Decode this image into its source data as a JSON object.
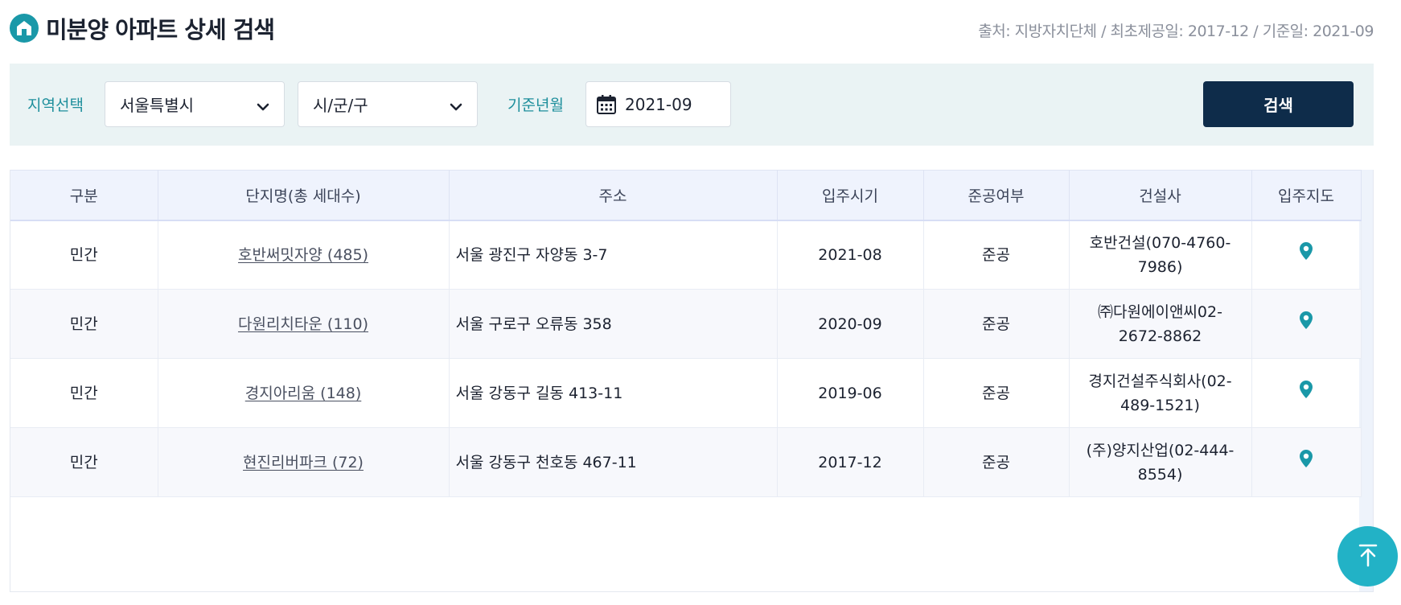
{
  "header": {
    "title": "미분양 아파트 상세 검색",
    "source": "출처: 지방자치단체 / 최초제공일: 2017-12 / 기준일: 2021-09"
  },
  "filters": {
    "region_label": "지역선택",
    "province": "서울특별시",
    "district": "시/군/구",
    "date_label": "기준년월",
    "date_value": "2021-09",
    "search_label": "검색"
  },
  "table": {
    "columns": [
      "구분",
      "단지명(총 세대수)",
      "주소",
      "입주시기",
      "준공여부",
      "건설사",
      "입주지도"
    ],
    "rows": [
      {
        "type": "민간",
        "name": "호반써밋자양 (485)",
        "address": "서울 광진구 자양동 3-7",
        "move_in": "2021-08",
        "status": "준공",
        "builder": "호반건설(070-4760-7986)"
      },
      {
        "type": "민간",
        "name": "다원리치타운 (110)",
        "address": "서울 구로구 오류동 358",
        "move_in": "2020-09",
        "status": "준공",
        "builder": "㈜다원에이앤씨02-2672-8862"
      },
      {
        "type": "민간",
        "name": "경지아리움 (148)",
        "address": "서울 강동구 길동 413-11",
        "move_in": "2019-06",
        "status": "준공",
        "builder": "경지건설주식회사(02-489-1521)"
      },
      {
        "type": "민간",
        "name": "현진리버파크 (72)",
        "address": "서울 강동구 천호동 467-11",
        "move_in": "2017-12",
        "status": "준공",
        "builder": "(주)양지산업(02-444-8554)"
      }
    ]
  },
  "icons": {
    "home": "home-icon",
    "chevron": "chevron-down-icon",
    "calendar": "calendar-icon",
    "map_pin": "map-pin-icon",
    "scroll_top": "arrow-up-icon"
  },
  "colors": {
    "accent": "#1a98a8",
    "button_dark": "#0e2c4a",
    "top_button": "#22b2c6"
  }
}
